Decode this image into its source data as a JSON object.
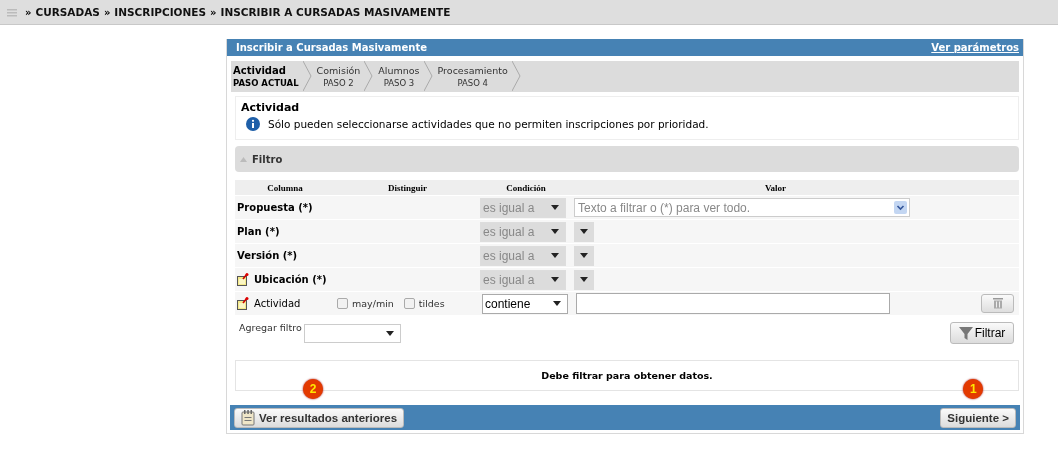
{
  "breadcrumb": {
    "separator": "»",
    "items": [
      "CURSADAS",
      "INSCRIPCIONES",
      "INSCRIBIR A CURSADAS MASIVAMENTE"
    ]
  },
  "panel": {
    "title": "Inscribir a Cursadas Masivamente",
    "link": "Ver parámetros"
  },
  "steps": [
    {
      "title": "Actividad",
      "subtitle": "PASO ACTUAL",
      "selected": true
    },
    {
      "title": "Comisión",
      "subtitle": "PASO 2",
      "selected": false
    },
    {
      "title": "Alumnos",
      "subtitle": "PASO 3",
      "selected": false
    },
    {
      "title": "Procesamiento",
      "subtitle": "PASO 4",
      "selected": false
    }
  ],
  "info": {
    "heading": "Actividad",
    "message": "Sólo pueden seleccionarse actividades que no permiten inscripciones por prioridad."
  },
  "filter": {
    "title": "Filtro",
    "expanded": true,
    "columns": [
      "Columna",
      "Distinguir",
      "Condición",
      "Valor"
    ],
    "rows": [
      {
        "label": "Propuesta (*)",
        "kind": "fixed",
        "note_icon": false,
        "condition": "es igual a",
        "disabled": true,
        "value": {
          "kind": "combo",
          "placeholder": "Texto a filtrar o (*) para ver todo."
        }
      },
      {
        "label": "Plan (*)",
        "kind": "fixed",
        "note_icon": false,
        "condition": "es igual a",
        "disabled": true,
        "value": {
          "kind": "select"
        }
      },
      {
        "label": "Versión (*)",
        "kind": "fixed",
        "note_icon": false,
        "condition": "es igual a",
        "disabled": true,
        "value": {
          "kind": "select"
        }
      },
      {
        "label": "Ubicación (*)",
        "kind": "fixed",
        "note_icon": true,
        "condition": "es igual a",
        "disabled": true,
        "value": {
          "kind": "select"
        }
      },
      {
        "label": "Actividad",
        "kind": "optional",
        "note_icon": true,
        "options": [
          {
            "label": "may/min",
            "checked": false
          },
          {
            "label": "tildes",
            "checked": false
          }
        ],
        "condition": "contiene",
        "disabled": false,
        "value": {
          "kind": "text"
        }
      }
    ],
    "add_filter_label": "Agregar filtro",
    "filter_button": "Filtrar"
  },
  "message": "Debe filtrar para obtener datos.",
  "footer": {
    "buttons": [
      {
        "label": "Ver resultados anteriores",
        "kind": "back",
        "badge": "2"
      },
      {
        "label": "Siguiente >",
        "kind": "next",
        "badge": "1"
      }
    ]
  }
}
